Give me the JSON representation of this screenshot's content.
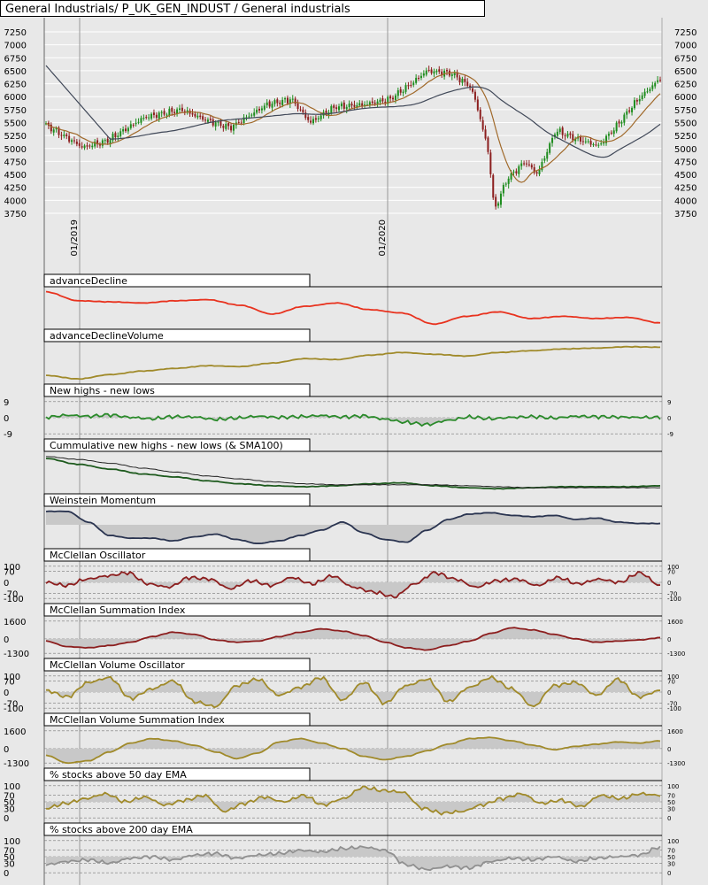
{
  "header": {
    "title": "General Industrials/ P_UK_GEN_INDUST / General industrials"
  },
  "colors": {
    "background": "#e8e8e8",
    "plot_bg": "#e8e8e8",
    "grid": "#ffffff",
    "candle_up": "#1e8c1e",
    "candle_down": "#8c1e1e",
    "ma_fast": "#a0692a",
    "ma_slow": "#404858",
    "advance_decline": "#e8321e",
    "gold": "#a08a2a",
    "green": "#2a8a2a",
    "navy": "#2a3450",
    "maroon": "#8c1e1e",
    "gray_line": "#909090",
    "fill": "#c8c8c8"
  },
  "chart_data": [
    {
      "type": "candlestick",
      "name": "price",
      "y_ticks": [
        "7250",
        "7000",
        "6750",
        "6500",
        "6250",
        "6000",
        "5750",
        "5500",
        "5250",
        "5000",
        "4750",
        "4500",
        "4250",
        "4000",
        "3750"
      ],
      "ylim": [
        3750,
        7250
      ],
      "x_tick_labels": [
        "01/2019",
        "01/2020"
      ],
      "overlays": [
        "moving average (brown)",
        "moving average (dark gray)"
      ],
      "approx_close_path": [
        [
          0,
          5450
        ],
        [
          0.06,
          5020
        ],
        [
          0.1,
          5150
        ],
        [
          0.16,
          5600
        ],
        [
          0.22,
          5750
        ],
        [
          0.26,
          5550
        ],
        [
          0.3,
          5400
        ],
        [
          0.36,
          5850
        ],
        [
          0.4,
          5950
        ],
        [
          0.43,
          5500
        ],
        [
          0.47,
          5800
        ],
        [
          0.52,
          5850
        ],
        [
          0.56,
          5950
        ],
        [
          0.6,
          6300
        ],
        [
          0.62,
          6500
        ],
        [
          0.66,
          6450
        ],
        [
          0.69,
          6200
        ],
        [
          0.7,
          5900
        ],
        [
          0.72,
          4950
        ],
        [
          0.73,
          3800
        ],
        [
          0.75,
          4400
        ],
        [
          0.78,
          4750
        ],
        [
          0.8,
          4500
        ],
        [
          0.83,
          5350
        ],
        [
          0.86,
          5200
        ],
        [
          0.9,
          5050
        ],
        [
          0.93,
          5450
        ],
        [
          0.96,
          5900
        ],
        [
          1.0,
          6350
        ]
      ]
    },
    {
      "type": "line",
      "name": "advanceDecline",
      "series": [
        {
          "values": [
            0.76,
            0.6,
            0.58,
            0.56,
            0.6,
            0.62,
            0.52,
            0.36,
            0.5,
            0.56,
            0.44,
            0.38,
            0.18,
            0.32,
            0.4,
            0.28,
            0.32,
            0.28,
            0.3,
            0.2
          ]
        }
      ]
    },
    {
      "type": "line",
      "name": "advanceDeclineVolume",
      "series": [
        {
          "values": [
            0.34,
            0.26,
            0.36,
            0.44,
            0.5,
            0.56,
            0.54,
            0.62,
            0.72,
            0.7,
            0.8,
            0.86,
            0.82,
            0.78,
            0.86,
            0.9,
            0.94,
            0.96,
            0.99,
            0.98
          ]
        }
      ]
    },
    {
      "type": "line",
      "name": "New highs - new lows",
      "y_ticks": [
        "9",
        "0",
        "-9"
      ],
      "series": [
        {
          "values": [
            0.3,
            1.4,
            0.8,
            1.6,
            0.2,
            -0.6,
            0.6,
            0.4,
            -1.0,
            -0.2,
            0.8,
            0.2,
            0.6,
            1.2,
            0.4,
            1.0,
            -0.8,
            -2.6,
            -3.8,
            -1.4,
            0.4,
            -0.6,
            0.2,
            0.6,
            -0.2,
            0.8,
            0.6,
            0.4,
            0.2,
            0.2
          ]
        }
      ]
    },
    {
      "type": "line",
      "name": "Cummulative new highs - new lows (& SMA100)",
      "series": [
        {
          "values": [
            0.78,
            0.66,
            0.56,
            0.46,
            0.4,
            0.32,
            0.26,
            0.22,
            0.2,
            0.22,
            0.26,
            0.28,
            0.22,
            0.18,
            0.16,
            0.18,
            0.2,
            0.2,
            0.2,
            0.22
          ]
        },
        {
          "values": [
            0.82,
            0.76,
            0.68,
            0.58,
            0.5,
            0.42,
            0.36,
            0.3,
            0.26,
            0.24,
            0.24,
            0.24,
            0.24,
            0.22,
            0.2,
            0.18,
            0.18,
            0.18,
            0.18,
            0.18
          ]
        }
      ]
    },
    {
      "type": "line",
      "name": "Weinstein Momentum",
      "series": [
        {
          "values": [
            0.5,
            0.5,
            0.1,
            -0.4,
            -0.5,
            -0.5,
            -0.6,
            -0.45,
            -0.35,
            -0.55,
            -0.7,
            -0.6,
            -0.4,
            -0.2,
            0.1,
            -0.3,
            -0.55,
            -0.65,
            -0.2,
            0.2,
            0.4,
            0.45,
            0.35,
            0.3,
            0.35,
            0.2,
            0.25,
            0.1,
            0.05,
            0.05
          ]
        }
      ]
    },
    {
      "type": "line",
      "name": "McClellan Oscillator",
      "y_ticks": [
        "100",
        "70",
        "0",
        "-70",
        "-100"
      ],
      "series": [
        {
          "values": [
            0,
            -20,
            20,
            40,
            60,
            -10,
            -30,
            30,
            20,
            -40,
            10,
            -20,
            30,
            -10,
            40,
            -30,
            -60,
            -90,
            -10,
            60,
            20,
            -30,
            10,
            20,
            -20,
            30,
            -10,
            20,
            0,
            60,
            -20
          ]
        }
      ]
    },
    {
      "type": "line",
      "name": "McClellan Summation Index",
      "y_ticks": [
        "1600",
        "0",
        "-1300"
      ],
      "series": [
        {
          "values": [
            -200,
            -700,
            -800,
            -600,
            -300,
            200,
            600,
            400,
            -100,
            -300,
            -200,
            200,
            600,
            900,
            700,
            300,
            -300,
            -800,
            -1000,
            -600,
            -200,
            500,
            1000,
            800,
            400,
            0,
            -300,
            -200,
            -100,
            100
          ]
        }
      ]
    },
    {
      "type": "line",
      "name": "McClellan Volume Oscillator",
      "y_ticks": [
        "100",
        "70",
        "0",
        "-70",
        "-100"
      ],
      "series": [
        {
          "values": [
            10,
            -30,
            60,
            90,
            -40,
            20,
            70,
            -60,
            -90,
            40,
            80,
            -20,
            30,
            90,
            -50,
            60,
            -70,
            40,
            80,
            -60,
            30,
            90,
            20,
            -90,
            40,
            60,
            -20,
            80,
            -30,
            10
          ]
        }
      ]
    },
    {
      "type": "line",
      "name": "McClellan Volume Summation Index",
      "y_ticks": [
        "1600",
        "0",
        "-1300"
      ],
      "series": [
        {
          "values": [
            -600,
            -1300,
            -1100,
            -300,
            500,
            900,
            700,
            300,
            -300,
            -900,
            -400,
            600,
            900,
            500,
            0,
            -700,
            -1000,
            -700,
            -200,
            400,
            900,
            1000,
            700,
            300,
            -100,
            200,
            400,
            600,
            500,
            700
          ]
        }
      ]
    },
    {
      "type": "line",
      "name": "% stocks above 50 day EMA",
      "y_ticks": [
        "100",
        "70",
        "50",
        "30",
        "0"
      ],
      "series": [
        {
          "values": [
            30,
            45,
            60,
            75,
            50,
            65,
            40,
            55,
            70,
            20,
            45,
            65,
            50,
            70,
            40,
            60,
            95,
            85,
            80,
            30,
            15,
            20,
            40,
            60,
            75,
            45,
            55,
            35,
            70,
            60,
            75,
            70
          ]
        }
      ]
    },
    {
      "type": "line",
      "name": "% stocks above 200 day EMA",
      "y_ticks": [
        "100",
        "70",
        "50",
        "30",
        "0"
      ],
      "series": [
        {
          "values": [
            25,
            35,
            40,
            30,
            45,
            50,
            40,
            55,
            60,
            45,
            55,
            60,
            70,
            65,
            75,
            80,
            70,
            25,
            10,
            20,
            15,
            35,
            45,
            40,
            50,
            35,
            45,
            50,
            55,
            80
          ]
        }
      ]
    }
  ]
}
